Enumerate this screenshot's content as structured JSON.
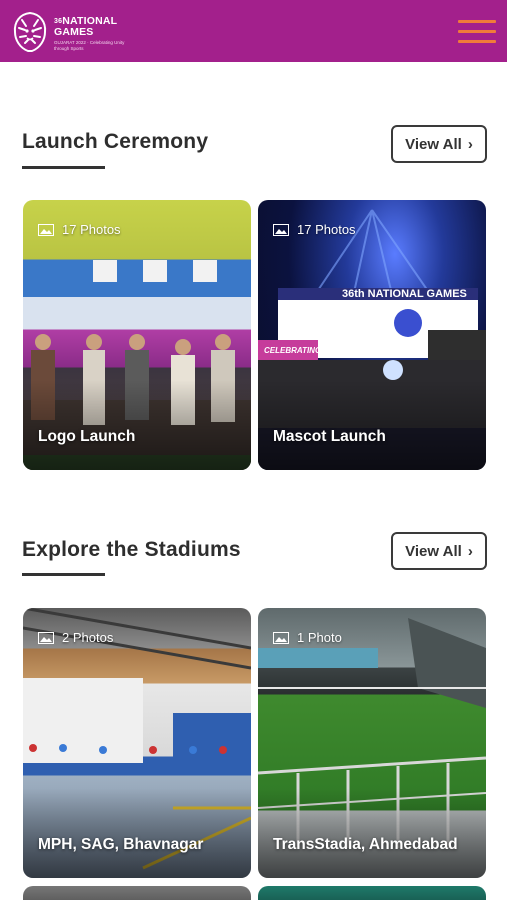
{
  "header": {
    "logo": {
      "line1": "36",
      "line2": "NATIONAL",
      "line3": "GAMES",
      "tagline": "GUJARAT 2022 · Celebrating Unity through Sports"
    },
    "menu_icon": "hamburger-icon",
    "colors": {
      "bar": "#a3208c",
      "menu": "#f07a3a"
    }
  },
  "sections": [
    {
      "title": "Launch Ceremony",
      "view_all": "View All",
      "cards": [
        {
          "count": "17 Photos",
          "title": "Logo Launch"
        },
        {
          "count": "17 Photos",
          "title": "Mascot Launch"
        }
      ]
    },
    {
      "title": "Explore the Stadiums",
      "view_all": "View All",
      "cards": [
        {
          "count": "2 Photos",
          "title": "MPH, SAG, Bhavnagar"
        },
        {
          "count": "1 Photo",
          "title": "TransStadia, Ahmedabad"
        }
      ]
    }
  ],
  "mascot_banner": {
    "line": "36th NATIONAL GAMES",
    "sub": "CELEBRATING"
  }
}
